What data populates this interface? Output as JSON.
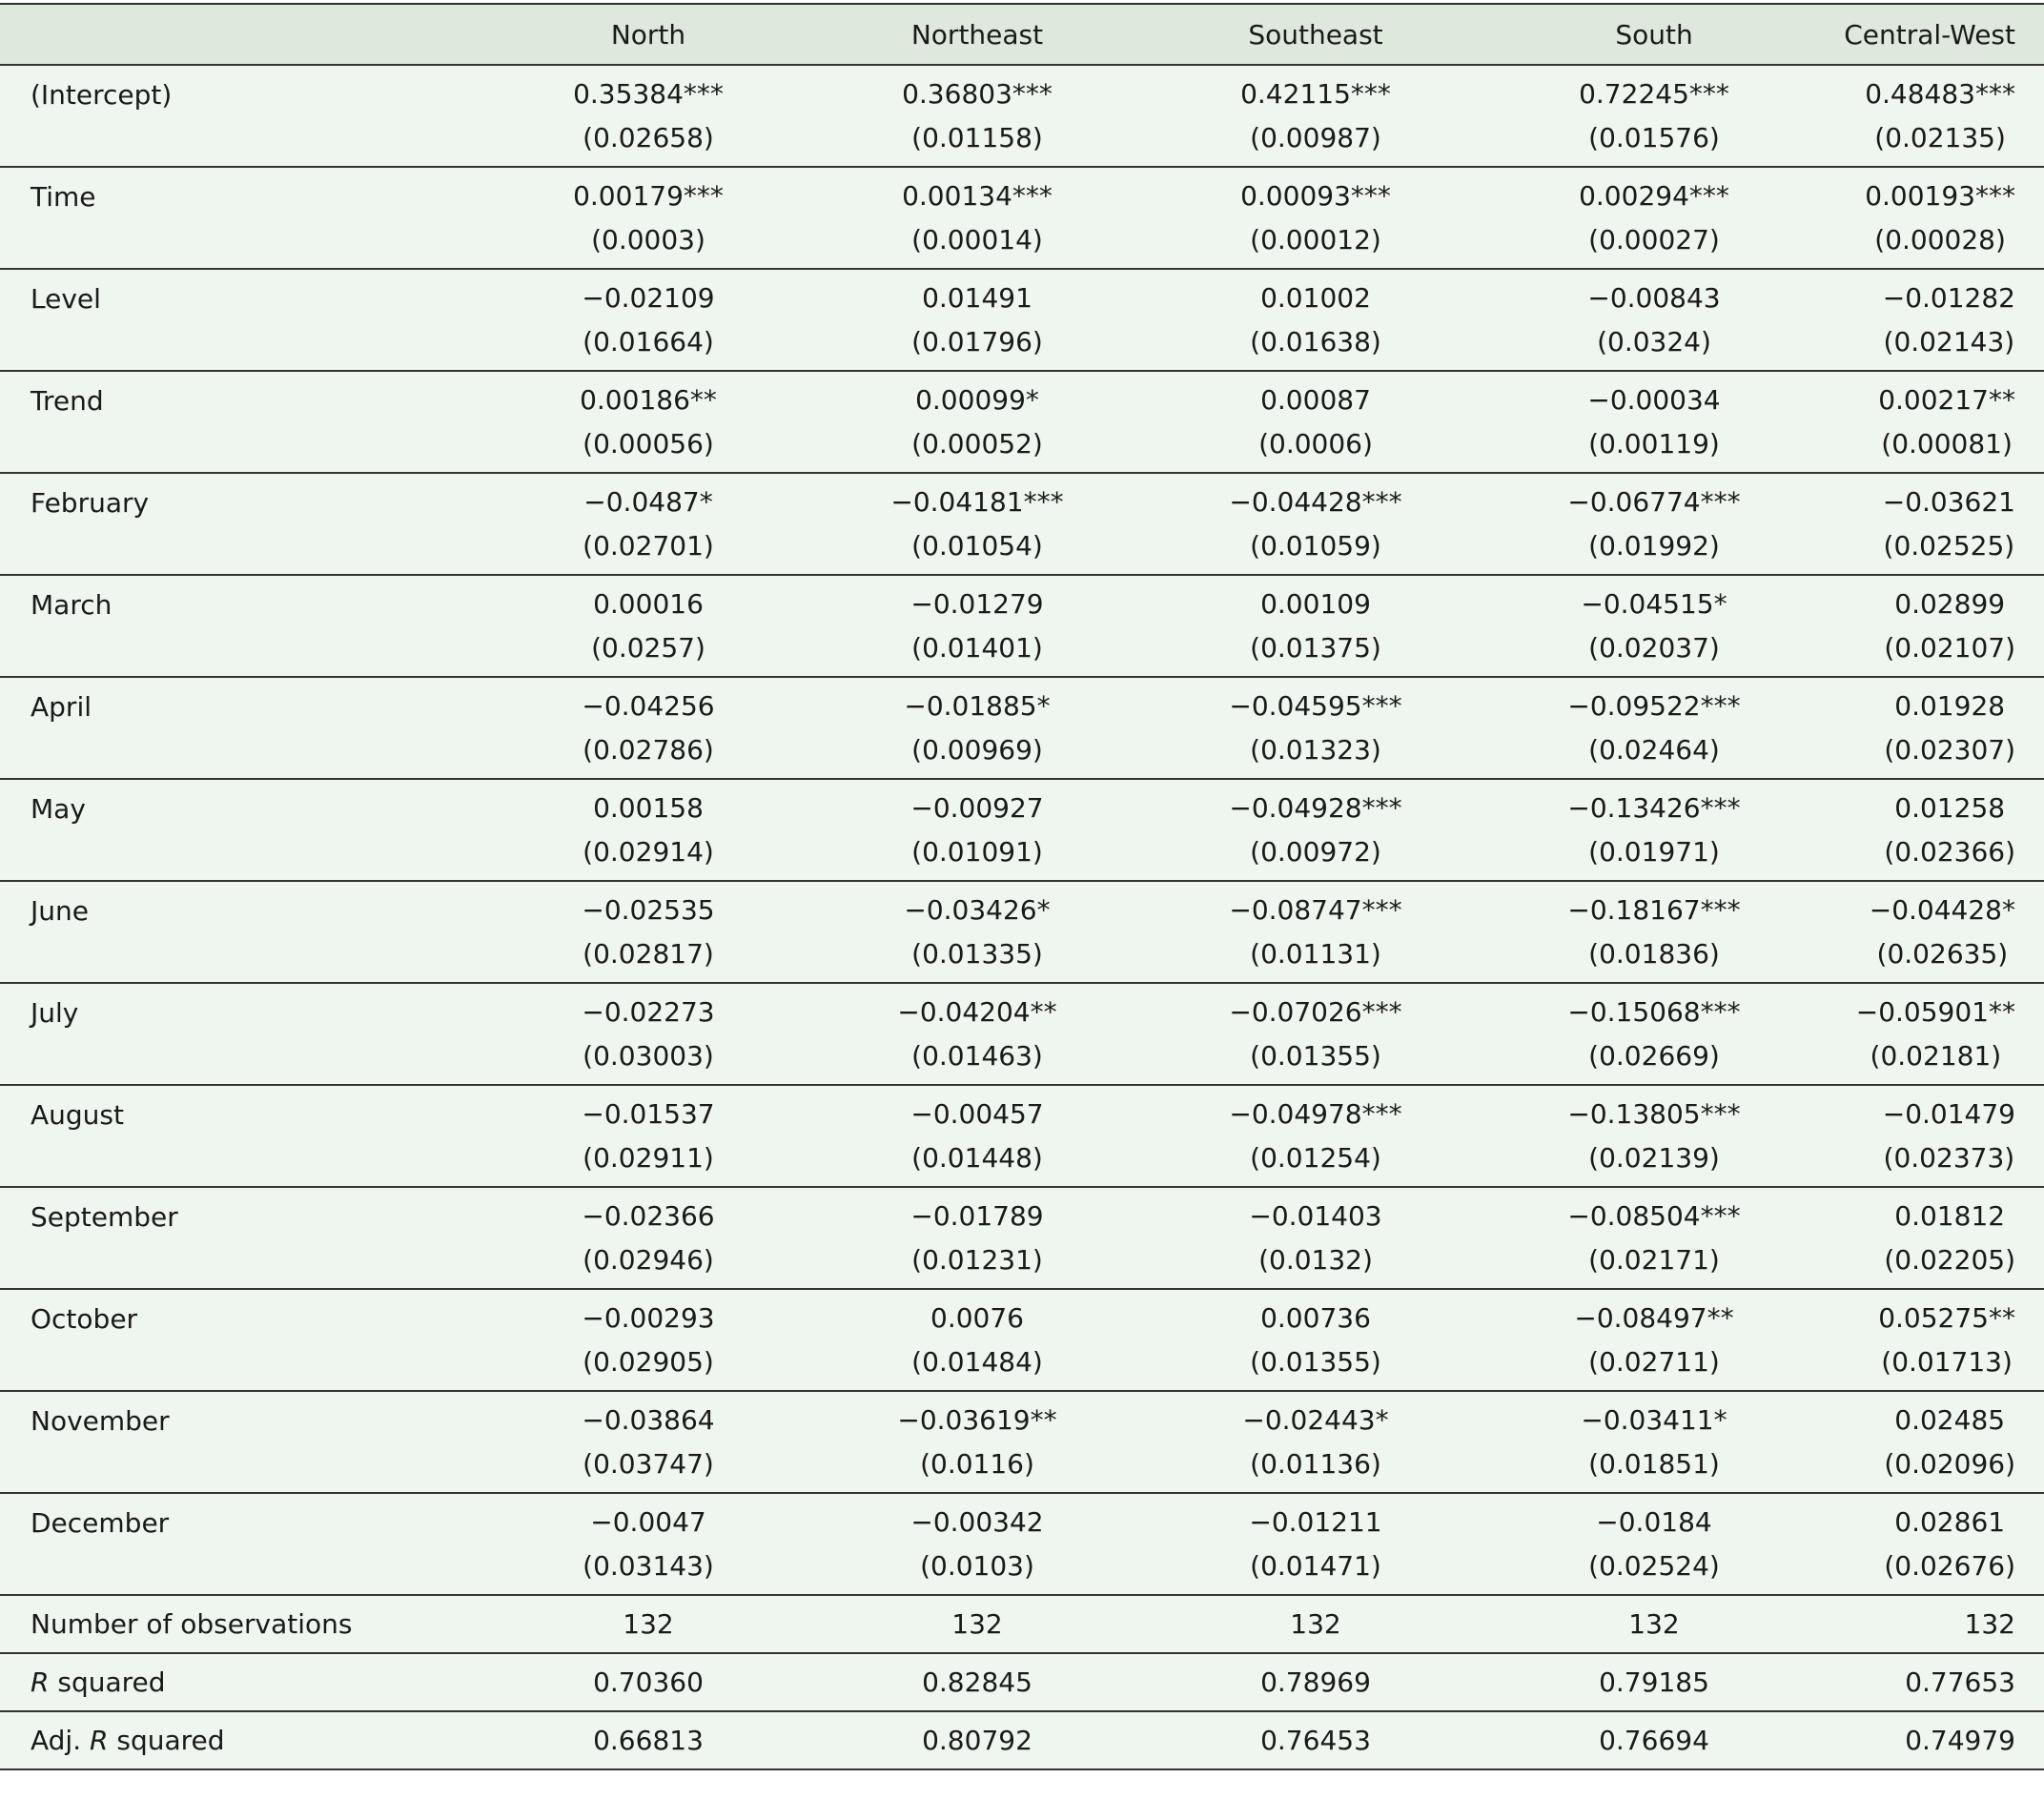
{
  "table": {
    "columns": [
      "North",
      "Northeast",
      "Southeast",
      "South",
      "Central-West"
    ],
    "rows": [
      {
        "label": "(Intercept)",
        "cells": [
          {
            "coef": "0.35384***",
            "se": "(0.02658)"
          },
          {
            "coef": "0.36803***",
            "se": "(0.01158)"
          },
          {
            "coef": "0.42115***",
            "se": "(0.00987)"
          },
          {
            "coef": "0.72245***",
            "se": "(0.01576)"
          },
          {
            "coef": "0.48483***",
            "se": "(0.02135)"
          }
        ]
      },
      {
        "label": "Time",
        "cells": [
          {
            "coef": "0.00179***",
            "se": "(0.0003)"
          },
          {
            "coef": "0.00134***",
            "se": "(0.00014)"
          },
          {
            "coef": "0.00093***",
            "se": "(0.00012)"
          },
          {
            "coef": "0.00294***",
            "se": "(0.00027)"
          },
          {
            "coef": "0.00193***",
            "se": "(0.00028)"
          }
        ]
      },
      {
        "label": "Level",
        "cells": [
          {
            "coef": "−0.02109",
            "se": "(0.01664)"
          },
          {
            "coef": "0.01491",
            "se": "(0.01796)"
          },
          {
            "coef": "0.01002",
            "se": "(0.01638)"
          },
          {
            "coef": "−0.00843",
            "se": "(0.0324)"
          },
          {
            "coef": "−0.01282",
            "se": "(0.02143)"
          }
        ]
      },
      {
        "label": "Trend",
        "cells": [
          {
            "coef": "0.00186**",
            "se": "(0.00056)"
          },
          {
            "coef": "0.00099*",
            "se": "(0.00052)"
          },
          {
            "coef": "0.00087",
            "se": "(0.0006)"
          },
          {
            "coef": "−0.00034",
            "se": "(0.00119)"
          },
          {
            "coef": "0.00217**",
            "se": "(0.00081)"
          }
        ]
      },
      {
        "label": "February",
        "cells": [
          {
            "coef": "−0.0487*",
            "se": "(0.02701)"
          },
          {
            "coef": "−0.04181***",
            "se": "(0.01054)"
          },
          {
            "coef": "−0.04428***",
            "se": "(0.01059)"
          },
          {
            "coef": "−0.06774***",
            "se": "(0.01992)"
          },
          {
            "coef": "−0.03621",
            "se": "(0.02525)"
          }
        ]
      },
      {
        "label": "March",
        "cells": [
          {
            "coef": "0.00016",
            "se": "(0.0257)"
          },
          {
            "coef": "−0.01279",
            "se": "(0.01401)"
          },
          {
            "coef": "0.00109",
            "se": "(0.01375)"
          },
          {
            "coef": "−0.04515*",
            "se": "(0.02037)"
          },
          {
            "coef": "0.02899",
            "se": "(0.02107)"
          }
        ]
      },
      {
        "label": "April",
        "cells": [
          {
            "coef": "−0.04256",
            "se": "(0.02786)"
          },
          {
            "coef": "−0.01885*",
            "se": "(0.00969)"
          },
          {
            "coef": "−0.04595***",
            "se": "(0.01323)"
          },
          {
            "coef": "−0.09522***",
            "se": "(0.02464)"
          },
          {
            "coef": "0.01928",
            "se": "(0.02307)"
          }
        ]
      },
      {
        "label": "May",
        "cells": [
          {
            "coef": "0.00158",
            "se": "(0.02914)"
          },
          {
            "coef": "−0.00927",
            "se": "(0.01091)"
          },
          {
            "coef": "−0.04928***",
            "se": "(0.00972)"
          },
          {
            "coef": "−0.13426***",
            "se": "(0.01971)"
          },
          {
            "coef": "0.01258",
            "se": "(0.02366)"
          }
        ]
      },
      {
        "label": "June",
        "cells": [
          {
            "coef": "−0.02535",
            "se": "(0.02817)"
          },
          {
            "coef": "−0.03426*",
            "se": "(0.01335)"
          },
          {
            "coef": "−0.08747***",
            "se": "(0.01131)"
          },
          {
            "coef": "−0.18167***",
            "se": "(0.01836)"
          },
          {
            "coef": "−0.04428*",
            "se": "(0.02635)"
          }
        ]
      },
      {
        "label": "July",
        "cells": [
          {
            "coef": "−0.02273",
            "se": "(0.03003)"
          },
          {
            "coef": "−0.04204**",
            "se": "(0.01463)"
          },
          {
            "coef": "−0.07026***",
            "se": "(0.01355)"
          },
          {
            "coef": "−0.15068***",
            "se": "(0.02669)"
          },
          {
            "coef": "−0.05901**",
            "se": "(0.02181)"
          }
        ]
      },
      {
        "label": "August",
        "cells": [
          {
            "coef": "−0.01537",
            "se": "(0.02911)"
          },
          {
            "coef": "−0.00457",
            "se": "(0.01448)"
          },
          {
            "coef": "−0.04978***",
            "se": "(0.01254)"
          },
          {
            "coef": "−0.13805***",
            "se": "(0.02139)"
          },
          {
            "coef": "−0.01479",
            "se": "(0.02373)"
          }
        ]
      },
      {
        "label": "September",
        "cells": [
          {
            "coef": "−0.02366",
            "se": "(0.02946)"
          },
          {
            "coef": "−0.01789",
            "se": "(0.01231)"
          },
          {
            "coef": "−0.01403",
            "se": "(0.0132)"
          },
          {
            "coef": "−0.08504***",
            "se": "(0.02171)"
          },
          {
            "coef": "0.01812",
            "se": "(0.02205)"
          }
        ]
      },
      {
        "label": "October",
        "cells": [
          {
            "coef": "−0.00293",
            "se": "(0.02905)"
          },
          {
            "coef": "0.0076",
            "se": "(0.01484)"
          },
          {
            "coef": "0.00736",
            "se": "(0.01355)"
          },
          {
            "coef": "−0.08497**",
            "se": "(0.02711)"
          },
          {
            "coef": "0.05275**",
            "se": "(0.01713)"
          }
        ]
      },
      {
        "label": "November",
        "cells": [
          {
            "coef": "−0.03864",
            "se": "(0.03747)"
          },
          {
            "coef": "−0.03619**",
            "se": "(0.0116)"
          },
          {
            "coef": "−0.02443*",
            "se": "(0.01136)"
          },
          {
            "coef": "−0.03411*",
            "se": "(0.01851)"
          },
          {
            "coef": "0.02485",
            "se": "(0.02096)"
          }
        ]
      },
      {
        "label": "December",
        "cells": [
          {
            "coef": "−0.0047",
            "se": "(0.03143)"
          },
          {
            "coef": "−0.00342",
            "se": "(0.0103)"
          },
          {
            "coef": "−0.01211",
            "se": "(0.01471)"
          },
          {
            "coef": "−0.0184",
            "se": "(0.02524)"
          },
          {
            "coef": "0.02861",
            "se": "(0.02676)"
          }
        ]
      }
    ],
    "stats": [
      {
        "label": "Number of observations",
        "values": [
          "132",
          "132",
          "132",
          "132",
          "132"
        ]
      },
      {
        "label_italic": "R",
        "label_rest": " squared",
        "values": [
          "0.70360",
          "0.82845",
          "0.78969",
          "0.79185",
          "0.77653"
        ]
      },
      {
        "label_prefix": "Adj. ",
        "label_italic": "R",
        "label_rest": " squared",
        "values": [
          "0.66813",
          "0.80792",
          "0.76453",
          "0.76694",
          "0.74979"
        ]
      }
    ]
  },
  "colors": {
    "header_bg": "#dee8dc",
    "row_bg": "#eff5ef",
    "rule": "#333333"
  }
}
